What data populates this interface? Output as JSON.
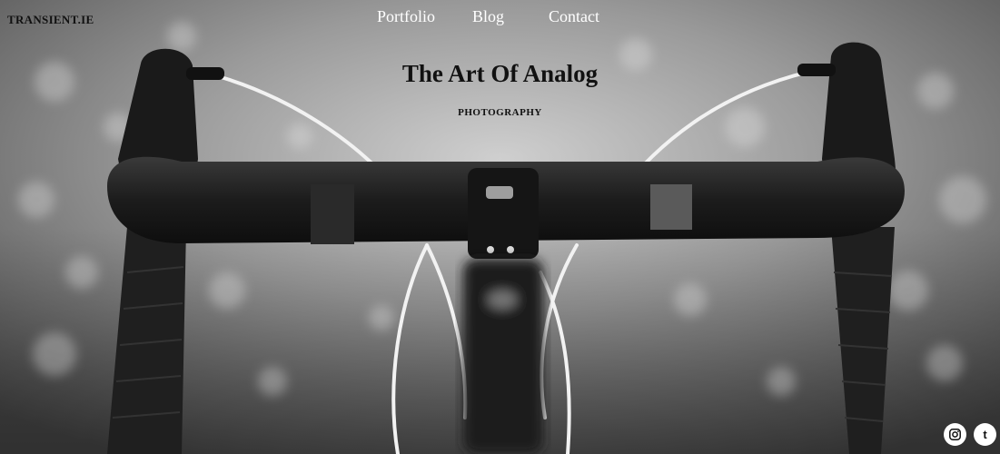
{
  "site": {
    "brand": "TRANSIENT.IE"
  },
  "nav": {
    "items": [
      {
        "label": "Portfolio"
      },
      {
        "label": "Blog"
      },
      {
        "label": "Contact"
      }
    ]
  },
  "hero": {
    "title": "The Art Of Analog",
    "subtitle": "PHOTOGRAPHY",
    "image_subject": "black-and-white photo of road bicycle handlebars with brake cables"
  },
  "social": {
    "instagram": {
      "icon": "instagram-icon",
      "glyph": "◎"
    },
    "tumblr": {
      "icon": "tumblr-icon",
      "glyph": "t"
    }
  }
}
